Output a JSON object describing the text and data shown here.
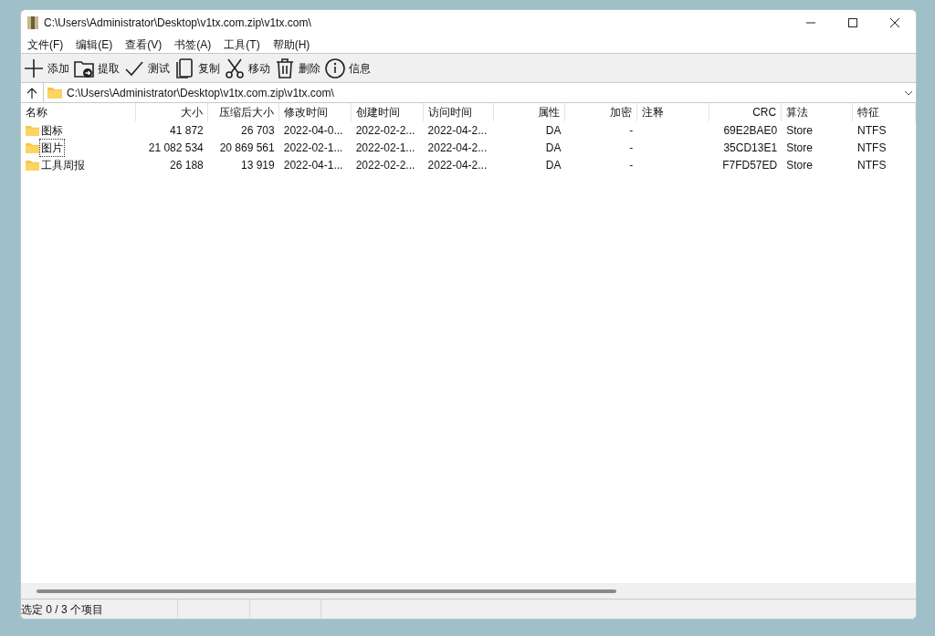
{
  "window": {
    "title": "C:\\Users\\Administrator\\Desktop\\v1tx.com.zip\\v1tx.com\\"
  },
  "menu": [
    "文件(F)",
    "编辑(E)",
    "查看(V)",
    "书签(A)",
    "工具(T)",
    "帮助(H)"
  ],
  "toolbar": [
    {
      "kind": "add",
      "label": "添加"
    },
    {
      "kind": "extract",
      "label": "提取"
    },
    {
      "kind": "test",
      "label": "测试"
    },
    {
      "kind": "copy",
      "label": "复制"
    },
    {
      "kind": "move",
      "label": "移动"
    },
    {
      "kind": "delete",
      "label": "删除"
    },
    {
      "kind": "info",
      "label": "信息"
    }
  ],
  "address": {
    "value": "C:\\Users\\Administrator\\Desktop\\v1tx.com.zip\\v1tx.com\\"
  },
  "table": {
    "columns": [
      {
        "label": "名称",
        "kind": "text"
      },
      {
        "label": "大小",
        "kind": "number"
      },
      {
        "label": "压缩后大小",
        "kind": "number"
      },
      {
        "label": "修改时间",
        "kind": "text"
      },
      {
        "label": "创建时间",
        "kind": "text"
      },
      {
        "label": "访问时间",
        "kind": "text"
      },
      {
        "label": "属性",
        "kind": "number"
      },
      {
        "label": "加密",
        "kind": "number"
      },
      {
        "label": "注释",
        "kind": "text"
      },
      {
        "label": "CRC",
        "kind": "number"
      },
      {
        "label": "算法",
        "kind": "text"
      },
      {
        "label": "特征",
        "kind": "text"
      }
    ],
    "rows": [
      {
        "focused": false,
        "cells": [
          "图标",
          "41 872",
          "26 703",
          "2022-04-0...",
          "2022-02-2...",
          "2022-04-2...",
          "DA",
          "-",
          "",
          "69E2BAE0",
          "Store",
          "NTFS"
        ]
      },
      {
        "focused": true,
        "cells": [
          "图片",
          "21 082 534",
          "20 869 561",
          "2022-02-1...",
          "2022-02-1...",
          "2022-04-2...",
          "DA",
          "-",
          "",
          "35CD13E1",
          "Store",
          "NTFS"
        ]
      },
      {
        "focused": false,
        "cells": [
          "工具周报",
          "26 188",
          "13 919",
          "2022-04-1...",
          "2022-02-2...",
          "2022-04-2...",
          "DA",
          "-",
          "",
          "F7FD57ED",
          "Store",
          "NTFS"
        ]
      }
    ]
  },
  "status_bar": {
    "text": "选定 0 / 3 个项目"
  }
}
